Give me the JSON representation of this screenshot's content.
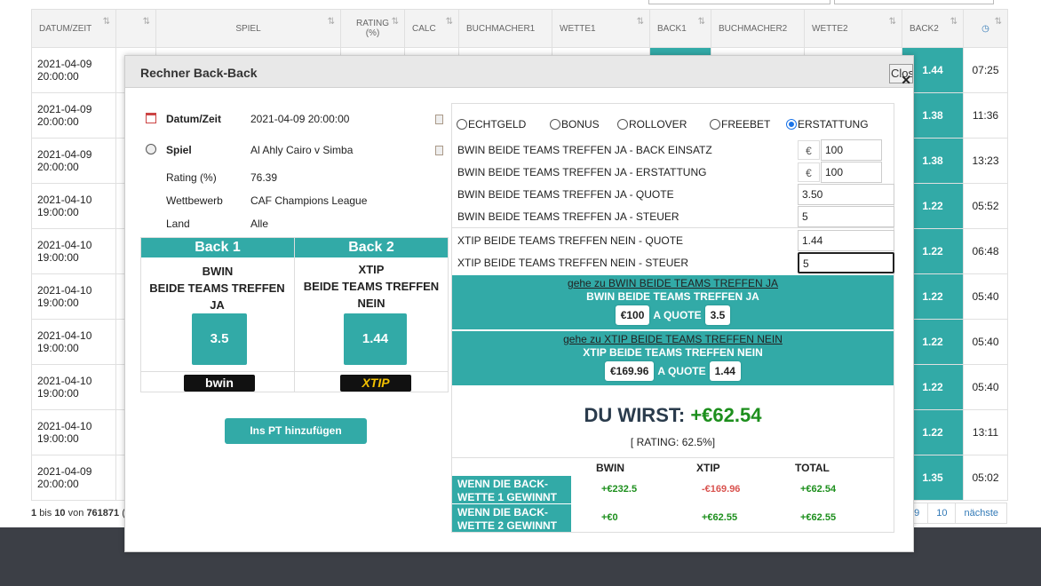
{
  "table": {
    "headers": [
      "DATUM/ZEIT",
      "",
      "SPIEL",
      "RATING (%)",
      "CALC",
      "BUCHMACHER1",
      "WETTE1",
      "BACK1",
      "BUCHMACHER2",
      "WETTE2",
      "BACK2",
      "clock"
    ],
    "rows": [
      {
        "date": "2021-04-09",
        "time": "20:00:00",
        "back2": "1.44",
        "t": "07:25"
      },
      {
        "date": "2021-04-09",
        "time": "20:00:00",
        "back2": "1.38",
        "t": "11:36"
      },
      {
        "date": "2021-04-09",
        "time": "20:00:00",
        "back2": "1.38",
        "t": "13:23"
      },
      {
        "date": "2021-04-10",
        "time": "19:00:00",
        "back2": "1.22",
        "t": "05:52"
      },
      {
        "date": "2021-04-10",
        "time": "19:00:00",
        "back2": "1.22",
        "t": "06:48"
      },
      {
        "date": "2021-04-10",
        "time": "19:00:00",
        "back2": "1.22",
        "t": "05:40"
      },
      {
        "date": "2021-04-10",
        "time": "19:00:00",
        "back2": "1.22",
        "t": "05:40"
      },
      {
        "date": "2021-04-10",
        "time": "19:00:00",
        "back2": "1.22",
        "t": "05:40"
      },
      {
        "date": "2021-04-10",
        "time": "19:00:00",
        "back2": "1.22",
        "t": "13:11"
      },
      {
        "date": "2021-04-09",
        "time": "20:00:00",
        "back2": "1.35",
        "t": "05:02"
      }
    ]
  },
  "pager": {
    "info_from": "1",
    "info_bis": "bis",
    "info_to": "10",
    "info_von": "von",
    "info_total": "761871",
    "info_tail": "(",
    "pages": [
      "9",
      "10",
      "nächste"
    ]
  },
  "modal": {
    "title": "Rechner Back-Back",
    "close_label": "Close",
    "info": {
      "date_label": "Datum/Zeit",
      "date_value": "2021-04-09 20:00:00",
      "game_label": "Spiel",
      "game_value": "Al Ahly Cairo v Simba",
      "rating_label": "Rating (%)",
      "rating_value": "76.39",
      "comp_label": "Wettbewerb",
      "comp_value": "CAF Champions League",
      "country_label": "Land",
      "country_value": "Alle"
    },
    "back1": {
      "head": "Back 1",
      "book": "BWIN",
      "bet": "BEIDE TEAMS TREFFEN JA",
      "odds": "3.5",
      "logo": "bwin"
    },
    "back2": {
      "head": "Back 2",
      "book": "XTIP",
      "bet": "BEIDE TEAMS TREFFEN NEIN",
      "odds": "1.44",
      "logo": "XTIP"
    },
    "add_pt_label": "Ins PT hinzufügen",
    "radios": [
      {
        "label": "ECHTGELD",
        "checked": false
      },
      {
        "label": "BONUS",
        "checked": false
      },
      {
        "label": "ROLLOVER",
        "checked": false
      },
      {
        "label": "FREEBET",
        "checked": false
      },
      {
        "label": "ERSTATTUNG",
        "checked": true
      }
    ],
    "fields": {
      "euro_symbol": "€",
      "stake_label": "BWIN BEIDE TEAMS TREFFEN JA - BACK EINSATZ",
      "stake_value": "100",
      "refund_label": "BWIN BEIDE TEAMS TREFFEN JA - ERSTATTUNG",
      "refund_value": "100",
      "quote1_label": "BWIN BEIDE TEAMS TREFFEN JA - QUOTE",
      "quote1_value": "3.50",
      "tax1_label": "BWIN BEIDE TEAMS TREFFEN JA - STEUER",
      "tax1_value": "5",
      "quote2_label": "XTIP BEIDE TEAMS TREFFEN NEIN  - QUOTE",
      "quote2_value": "1.44",
      "tax2_label": "XTIP BEIDE TEAMS TREFFEN NEIN - STEUER",
      "tax2_value": "5"
    },
    "block1": {
      "link": "gehe zu BWIN BEIDE TEAMS TREFFEN JA",
      "title": "BWIN BEIDE TEAMS TREFFEN JA",
      "stake": "€100",
      "a_quote": "A QUOTE",
      "quote": "3.5"
    },
    "block2": {
      "link": "gehe zu XTIP BEIDE TEAMS TREFFEN NEIN",
      "title": "XTIP BEIDE TEAMS TREFFEN NEIN",
      "stake": "€169.96",
      "a_quote": "A QUOTE",
      "quote": "1.44"
    },
    "result": {
      "prefix": "DU WIRST: ",
      "amount": "+€62.54",
      "rating": "[ RATING: 62.5%]"
    },
    "summary": {
      "headers": [
        "BWIN",
        "XTIP",
        "TOTAL"
      ],
      "row1_label": "WENN DIE BACK-WETTE 1 GEWINNT",
      "row1": [
        "+€232.5",
        "-€169.96",
        "+€62.54"
      ],
      "row2_label": "WENN DIE BACK-WETTE 2 GEWINNT",
      "row2": [
        "+€0",
        "+€62.55",
        "+€62.55"
      ]
    }
  }
}
